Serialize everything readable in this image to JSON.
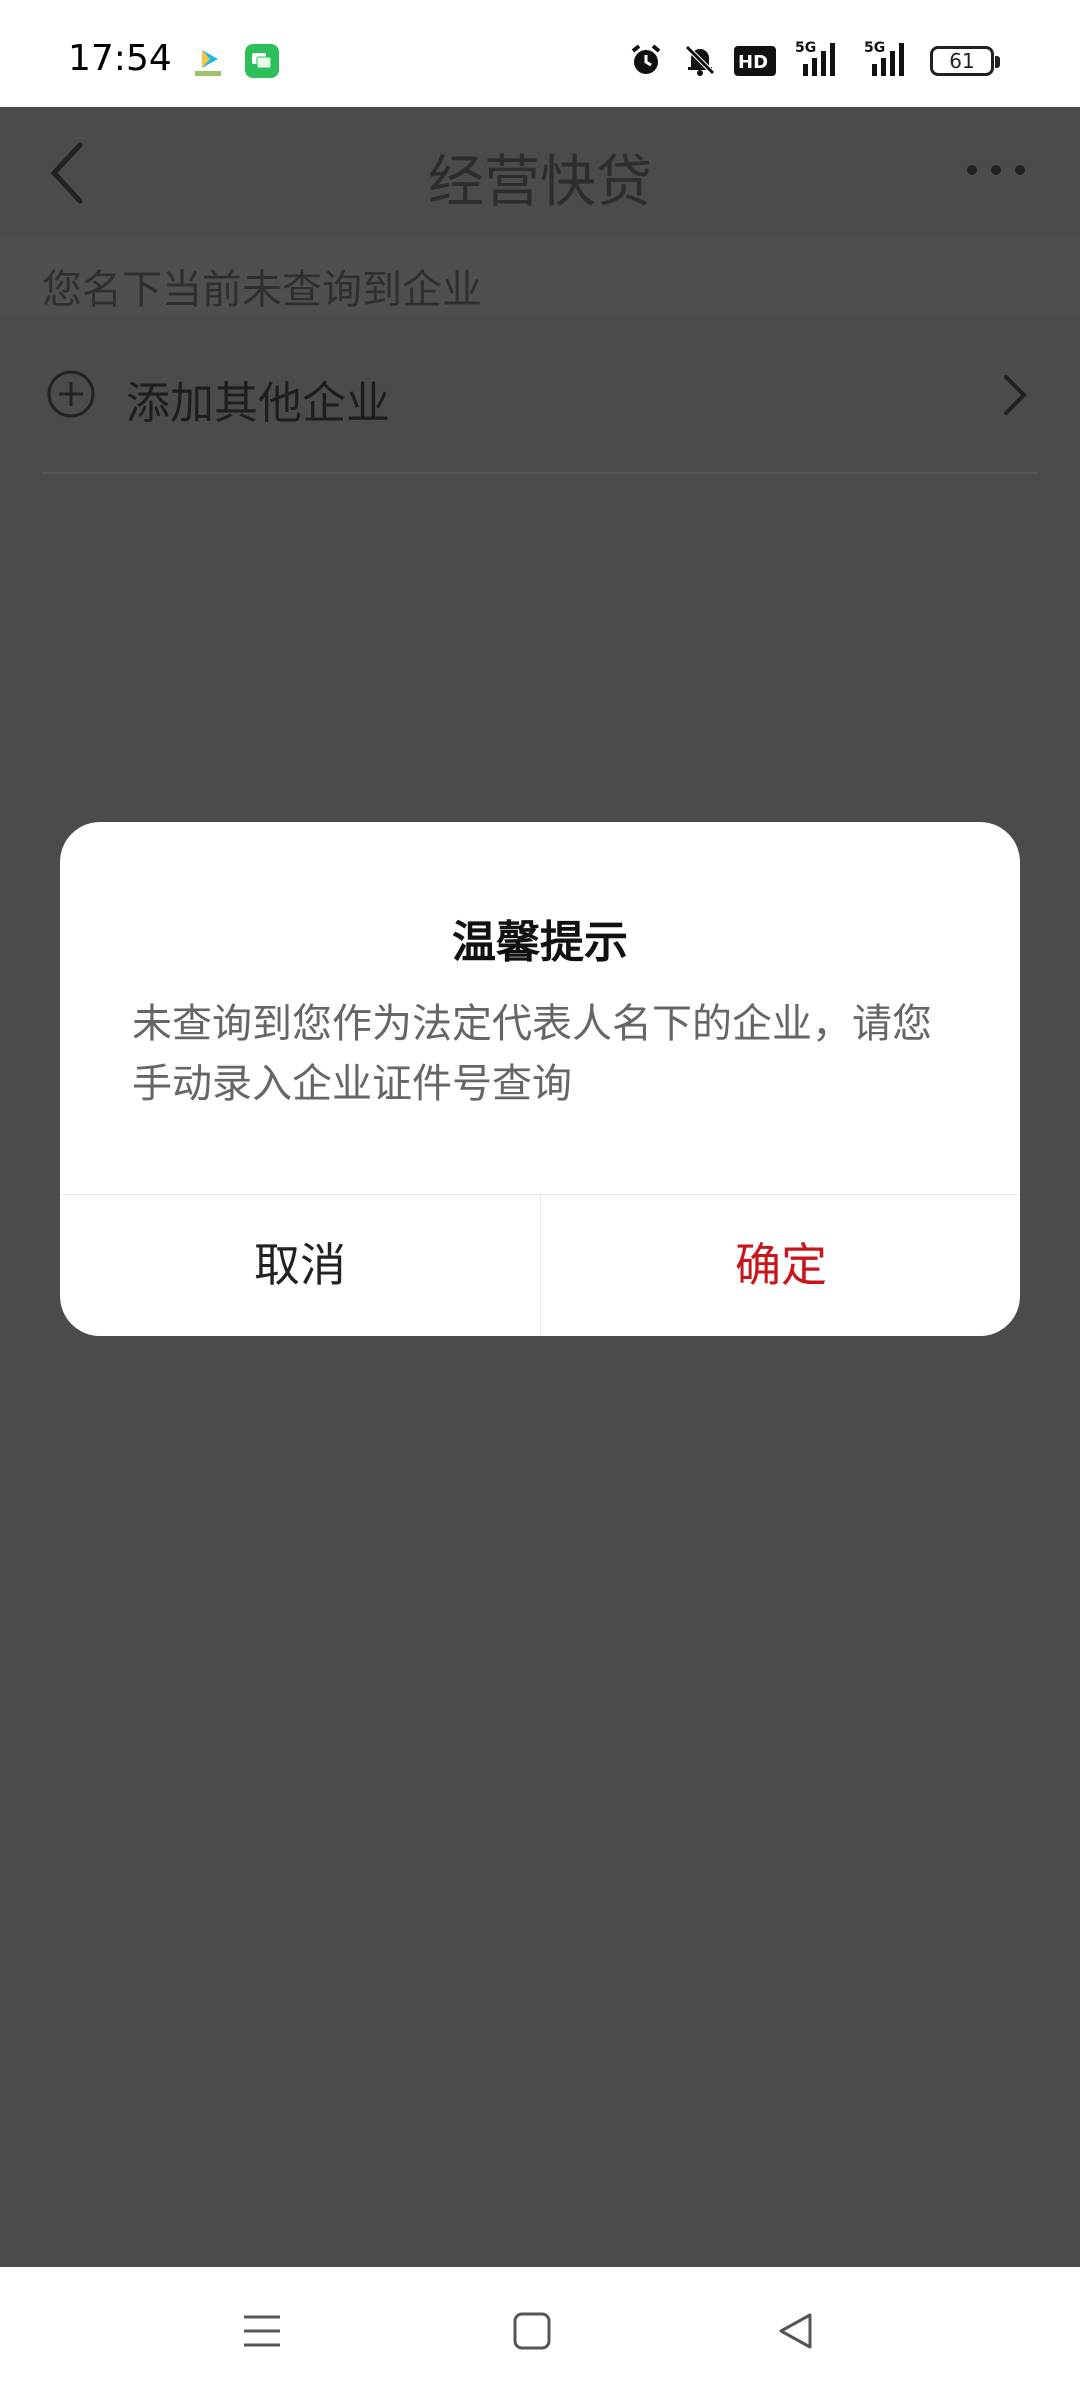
{
  "status_bar": {
    "time": "17:54",
    "battery": "61",
    "icons": [
      "app-video-icon",
      "app-chat-icon",
      "alarm-icon",
      "mute-bell-icon",
      "hd-icon",
      "signal-5g-icon",
      "signal-5g-icon"
    ]
  },
  "nav": {
    "title": "经营快贷"
  },
  "notice": {
    "text": "您名下当前未查询到企业"
  },
  "add_row": {
    "label": "添加其他企业"
  },
  "dialog": {
    "title": "温馨提示",
    "body": "未查询到您作为法定代表人名下的企业，请您手动录入企业证件号查询",
    "cancel_label": "取消",
    "confirm_label": "确定",
    "confirm_color": "#c8161d"
  },
  "system_nav": {
    "icons": [
      "menu-icon",
      "home-square-icon",
      "back-triangle-icon"
    ]
  }
}
